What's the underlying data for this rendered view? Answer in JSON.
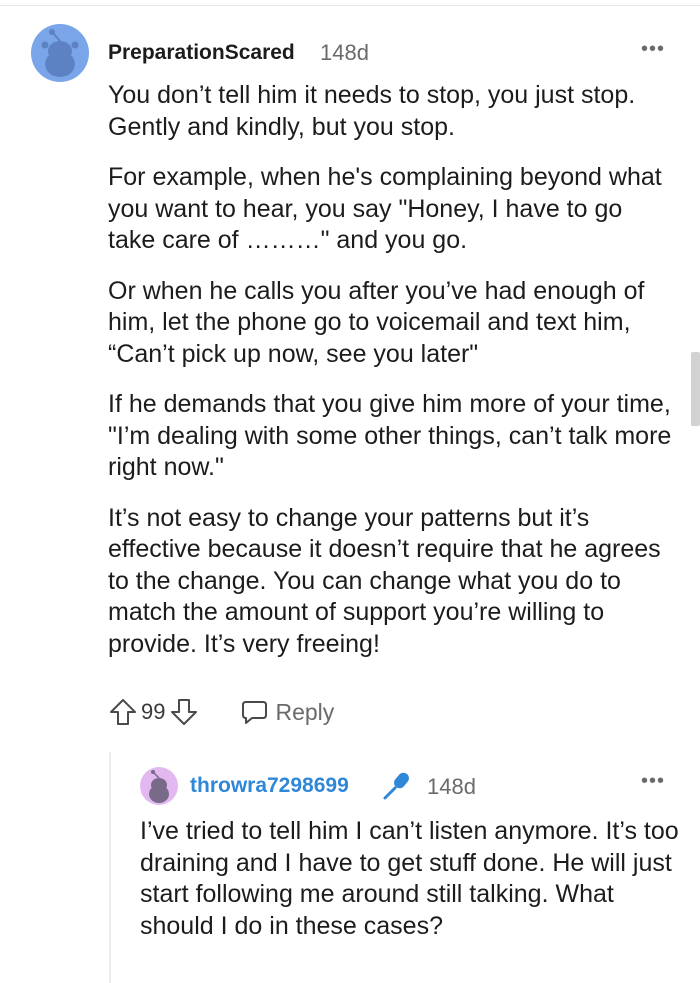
{
  "comment": {
    "username": "PreparationScared",
    "age": "148d",
    "more_label": "•••",
    "paragraphs": [
      "You don’t tell him it needs to stop, you just stop. Gently and kindly, but you stop.",
      "For example, when he's complaining beyond what you want to hear, you say \"Honey, I have to go take care of ………\" and you go.",
      "Or when he calls you after you’ve had enough of him, let the phone go to voicemail and text him, “Can’t pick up now, see you later\"",
      "If he demands that you give him more of your time, \"I’m dealing with some other things, can’t talk more right now.\"",
      "It’s not easy to change your patterns but it’s effective because it doesn’t require that he agrees to the change. You can change what you do to match the amount of support you’re willing to provide. It’s very freeing!"
    ],
    "score": "99",
    "reply_label": "Reply",
    "avatar_color": "#7aa5e8"
  },
  "reply": {
    "username": "throwra7298699",
    "age": "148d",
    "more_label": "•••",
    "paragraphs": [
      "I’ve tried to tell him I can’t listen anymore. It’s too draining and I have to get stuff done. He will just start following me around still talking. What should I do in these cases?"
    ],
    "username_color": "#2f87d8",
    "avatar_color": "#e3b8f0"
  }
}
